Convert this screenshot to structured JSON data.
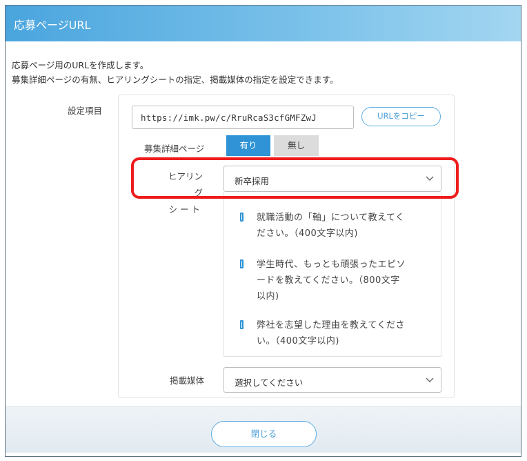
{
  "header": {
    "title": "応募ページURL"
  },
  "intro": {
    "line1": "応募ページ用のURLを作成します。",
    "line2": "募集詳細ページの有無、ヒアリングシートの指定、掲載媒体の指定を設定できます。"
  },
  "settings": {
    "section_label": "設定項目",
    "url": {
      "value": "https://imk.pw/c/RruRcaS3cfGMFZwJ",
      "copy_label": "URLをコピー"
    },
    "detail_page": {
      "label": "募集詳細ページ",
      "option_yes": "有り",
      "option_no": "無し",
      "selected": "有り"
    },
    "hearing_sheet": {
      "label_line1": "ヒアリング",
      "label_line2": "シート",
      "selected": "新卒採用",
      "questions": [
        {
          "line1": "就職活動の「軸」について教えてく",
          "line2": "ださい。（400文字以内)"
        },
        {
          "line1": "学生時代、もっとも頑張ったエピソ",
          "line2": "ードを教えてください。（800文字",
          "line3": "以内)"
        },
        {
          "line1": "弊社を志望した理由を教えてくださ",
          "line2": "い。（400文字以内)"
        }
      ]
    },
    "media": {
      "label": "掲載媒体",
      "placeholder": "選択してください"
    }
  },
  "footer": {
    "close_label": "閉じる"
  },
  "colors": {
    "accent": "#2f93d5",
    "highlight": "#ee1c1c"
  }
}
